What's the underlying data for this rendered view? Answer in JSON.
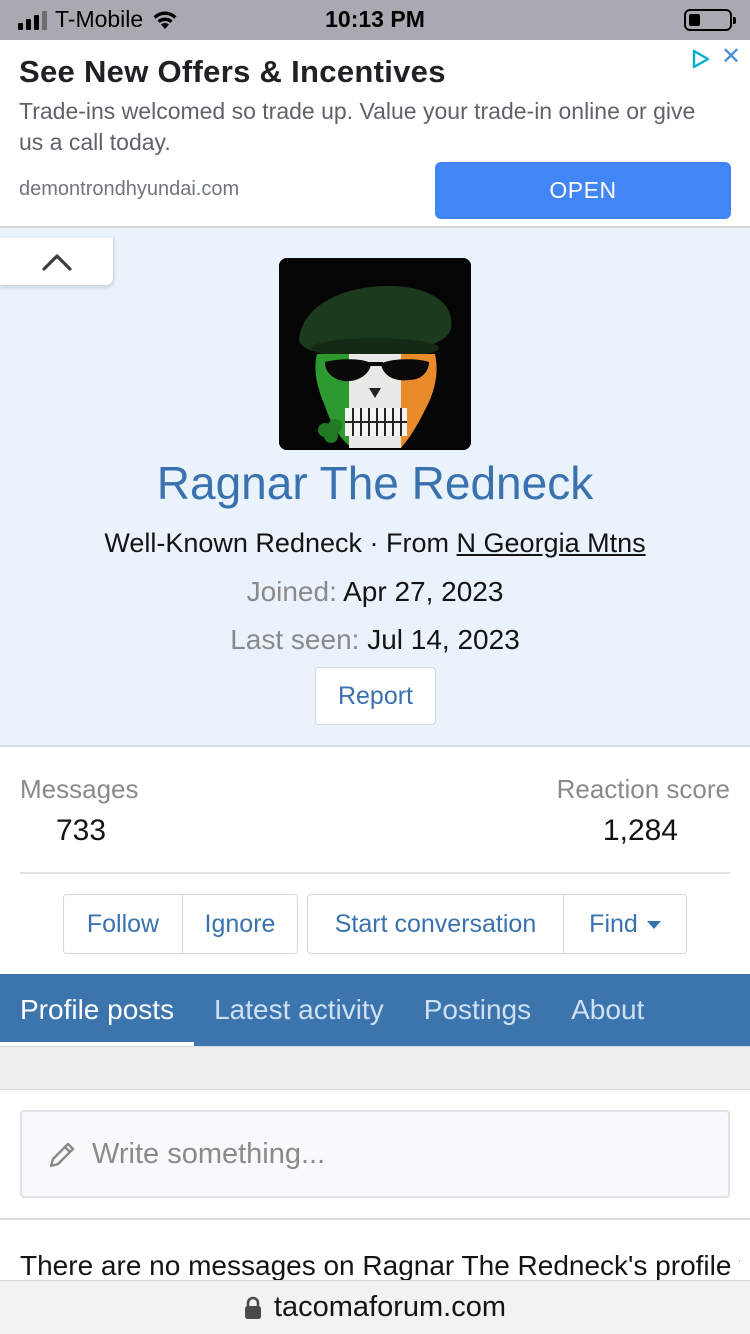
{
  "status_bar": {
    "carrier": "T-Mobile",
    "time": "10:13 PM",
    "signal_bars": 4,
    "signal_bars_filled": 3,
    "battery_level": 0.3
  },
  "ad": {
    "title": "See New Offers & Incentives",
    "text": "Trade-ins welcomed so trade up. Value your trade-in online or give us a call today.",
    "domain": "demontrondhyundai.com",
    "open_label": "OPEN",
    "button_color": "#4285f4"
  },
  "profile": {
    "name": "Ragnar The Redneck",
    "title": "Well-Known Redneck",
    "from_prefix": "From",
    "location": "N Georgia Mtns",
    "joined_label": "Joined:",
    "joined_date": "Apr 27, 2023",
    "last_seen_label": "Last seen:",
    "last_seen_date": "Jul 14, 2023",
    "report_label": "Report",
    "accent_color": "#3a72b0"
  },
  "stats": {
    "messages_label": "Messages",
    "messages_value": "733",
    "reaction_label": "Reaction score",
    "reaction_value": "1,284"
  },
  "actions": {
    "follow": "Follow",
    "ignore": "Ignore",
    "start_conversation": "Start conversation",
    "find": "Find"
  },
  "tabs": [
    {
      "label": "Profile posts",
      "active": true
    },
    {
      "label": "Latest activity",
      "active": false
    },
    {
      "label": "Postings",
      "active": false
    },
    {
      "label": "About",
      "active": false
    }
  ],
  "composer": {
    "placeholder": "Write something..."
  },
  "empty_message": "There are no messages on Ragnar The Redneck's profile yet.",
  "url_bar": {
    "domain": "tacomaforum.com"
  }
}
